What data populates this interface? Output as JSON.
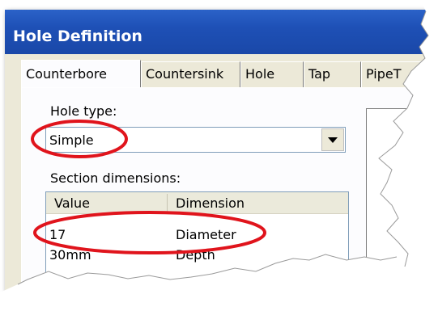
{
  "window": {
    "title": "Hole Definition"
  },
  "tabs": [
    {
      "label": "Counterbore",
      "active": true
    },
    {
      "label": "Countersink",
      "active": false
    },
    {
      "label": "Hole",
      "active": false
    },
    {
      "label": "Tap",
      "active": false
    },
    {
      "label": "PipeT",
      "active": false
    }
  ],
  "hole_type": {
    "label": "Hole type:",
    "value": "Simple"
  },
  "section": {
    "label": "Section dimensions:",
    "columns": [
      "Value",
      "Dimension"
    ],
    "rows": [
      {
        "value": "17",
        "dimension": "Diameter"
      },
      {
        "value": "30mm",
        "dimension": "Depth"
      }
    ]
  },
  "annotations": {
    "highlight_color": "#e0141c"
  }
}
